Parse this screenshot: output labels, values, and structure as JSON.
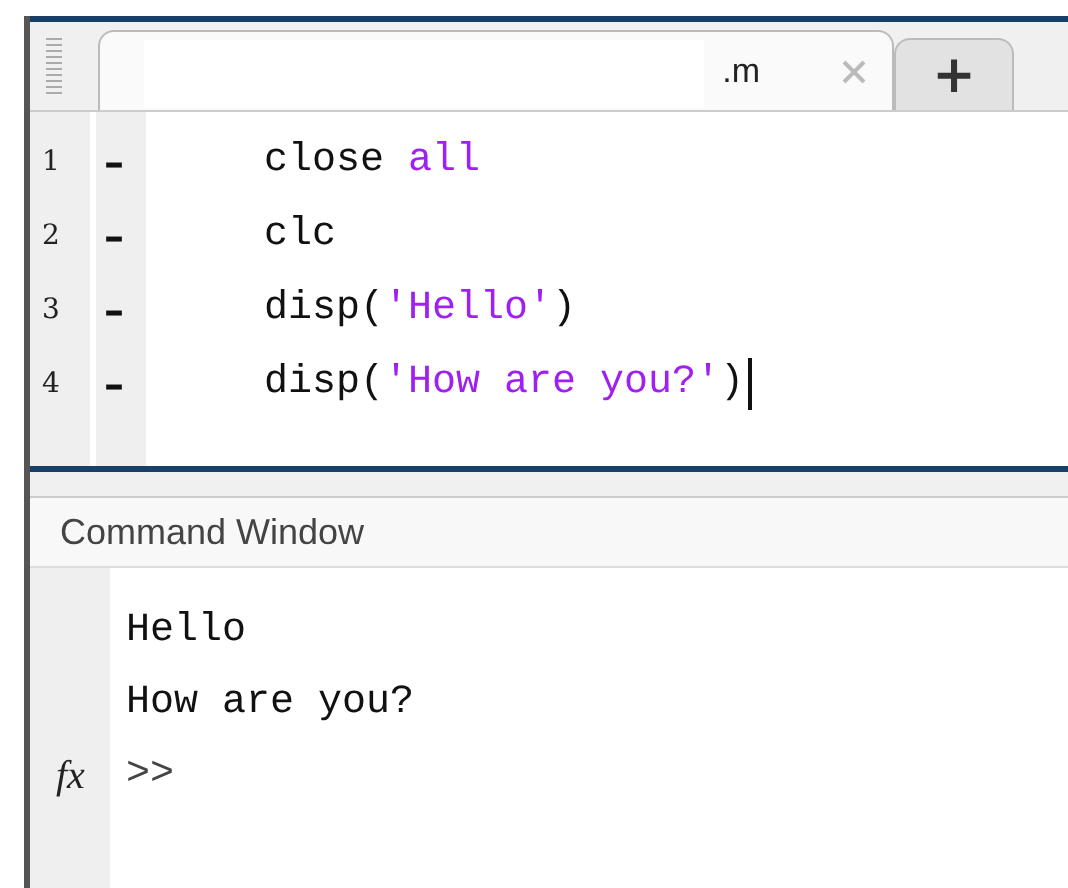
{
  "editor": {
    "tabs": [
      {
        "label": ".m",
        "selected": true
      }
    ],
    "add_tab": "+",
    "lines": [
      {
        "number": "1",
        "breakpoint_mark": "–",
        "tokens": [
          {
            "kind": "plain",
            "text": "close "
          },
          {
            "kind": "string",
            "text": "all"
          }
        ]
      },
      {
        "number": "2",
        "breakpoint_mark": "–",
        "tokens": [
          {
            "kind": "plain",
            "text": "clc"
          }
        ]
      },
      {
        "number": "3",
        "breakpoint_mark": "–",
        "tokens": [
          {
            "kind": "plain",
            "text": "disp("
          },
          {
            "kind": "string",
            "text": "'Hello'"
          },
          {
            "kind": "plain",
            "text": ")"
          }
        ]
      },
      {
        "number": "4",
        "breakpoint_mark": "–",
        "cursor": true,
        "tokens": [
          {
            "kind": "plain",
            "text": "disp("
          },
          {
            "kind": "string",
            "text": "'How are you?'"
          },
          {
            "kind": "plain",
            "text": ")"
          }
        ]
      }
    ]
  },
  "command_window": {
    "title": "Command Window",
    "output": [
      "Hello",
      "How are you?"
    ],
    "fx_label": "fx",
    "prompt": ">>"
  }
}
